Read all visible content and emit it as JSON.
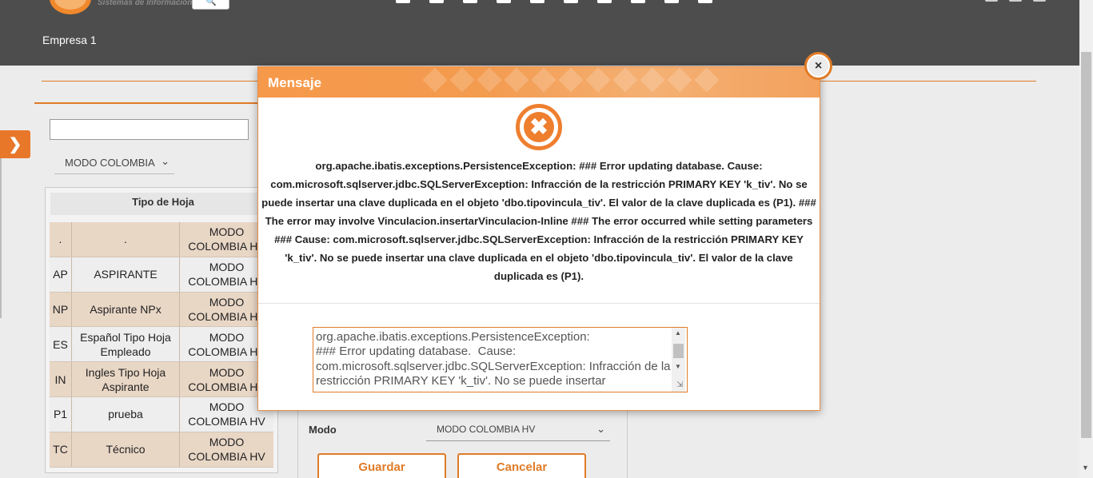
{
  "header": {
    "logo_subtitle": "Sistemas de Información",
    "company": "Empresa 1"
  },
  "filters": {
    "search_value": "",
    "mode_selected": "MODO COLOMBIA"
  },
  "table": {
    "header": "Tipo de Hoja",
    "rows": [
      {
        "code": ".",
        "name": ".",
        "mode": "MODO COLOMBIA HV"
      },
      {
        "code": "AP",
        "name": "ASPIRANTE",
        "mode": "MODO COLOMBIA HV"
      },
      {
        "code": "NP",
        "name": "Aspirante NPx",
        "mode": "MODO COLOMBIA HV"
      },
      {
        "code": "ES",
        "name": "Español Tipo Hoja Empleado",
        "mode": "MODO COLOMBIA HV"
      },
      {
        "code": "IN",
        "name": "Ingles Tipo Hoja Aspirante",
        "mode": "MODO COLOMBIA HV"
      },
      {
        "code": "P1",
        "name": "prueba",
        "mode": "MODO COLOMBIA HV"
      },
      {
        "code": "TC",
        "name": "Técnico",
        "mode": "MODO COLOMBIA HV"
      }
    ]
  },
  "form": {
    "mode_label": "Modo",
    "mode_value": "MODO COLOMBIA HV",
    "save_label": "Guardar",
    "cancel_label": "Cancelar"
  },
  "modal": {
    "title": "Mensaje",
    "close_glyph": "×",
    "message": "org.apache.ibatis.exceptions.PersistenceException: ### Error updating database. Cause: com.microsoft.sqlserver.jdbc.SQLServerException: Infracción de la restricción PRIMARY KEY 'k_tiv'. No se puede insertar una clave duplicada en el objeto 'dbo.tipovincula_tiv'. El valor de la clave duplicada es (P1). ### The error may involve Vinculacion.insertarVinculacion-Inline ### The error occurred while setting parameters ### Cause: com.microsoft.sqlserver.jdbc.SQLServerException: Infracción de la restricción PRIMARY KEY 'k_tiv'. No se puede insertar una clave duplicada en el objeto 'dbo.tipovincula_tiv'. El valor de la clave duplicada es (P1).",
    "detail": "org.apache.ibatis.exceptions.PersistenceException: \n### Error updating database.  Cause: com.microsoft.sqlserver.jdbc.SQLServerException: Infracción de la restricción PRIMARY KEY 'k_tiv'. No se puede insertar"
  },
  "colors": {
    "accent": "#e07b27",
    "header_bg": "#4d4d4d",
    "row_alt": "#e9d7c6"
  }
}
